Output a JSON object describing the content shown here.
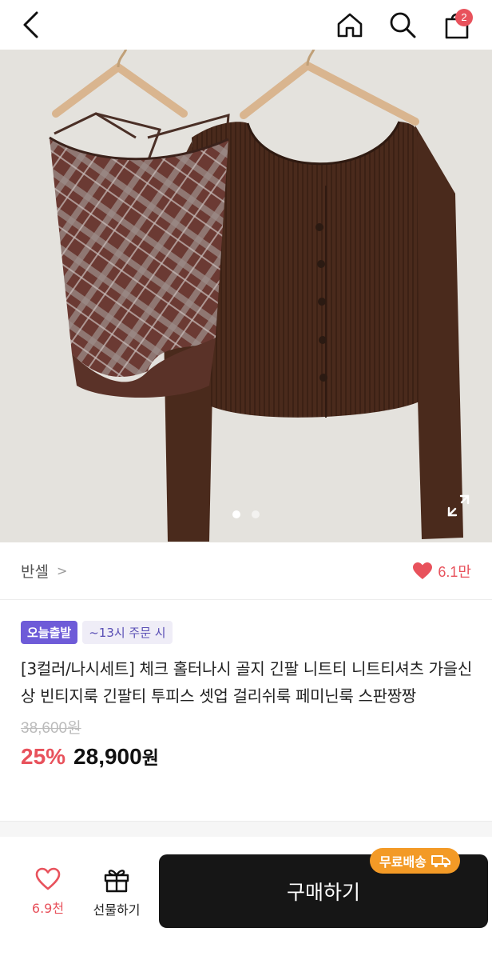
{
  "header": {
    "icons": {
      "back": "chevron-left-icon",
      "home": "home-icon",
      "search": "search-icon",
      "cart": "shopping-bag-icon"
    },
    "cart_count": "2"
  },
  "gallery": {
    "image_count": 2,
    "active_index": 0,
    "expand_icon": "expand-icon"
  },
  "seller": {
    "name": "반셀",
    "chevron": ">",
    "likes": "6.1만"
  },
  "badges": {
    "delivery": "오늘출발",
    "cutoff": "~13시 주문 시"
  },
  "product": {
    "title": "[3컬러/나시세트] 체크 홀터나시 골지 긴팔 니트티 니트티셔츠 가을신상 빈티지룩 긴팔티 투피스 셋업 걸리쉬룩 페미닌룩 스판짱짱",
    "original_price": "38,600원",
    "discount": "25%",
    "price": "28,900",
    "currency": "원"
  },
  "bottom_bar": {
    "wish_count": "6.9천",
    "gift_label": "선물하기",
    "buy_label": "구매하기",
    "free_shipping": "무료배송"
  },
  "colors": {
    "accent_red": "#e8525c",
    "badge_purple": "#6e5bd8",
    "shipping_orange": "#f39a26",
    "buy_button": "#161616"
  }
}
